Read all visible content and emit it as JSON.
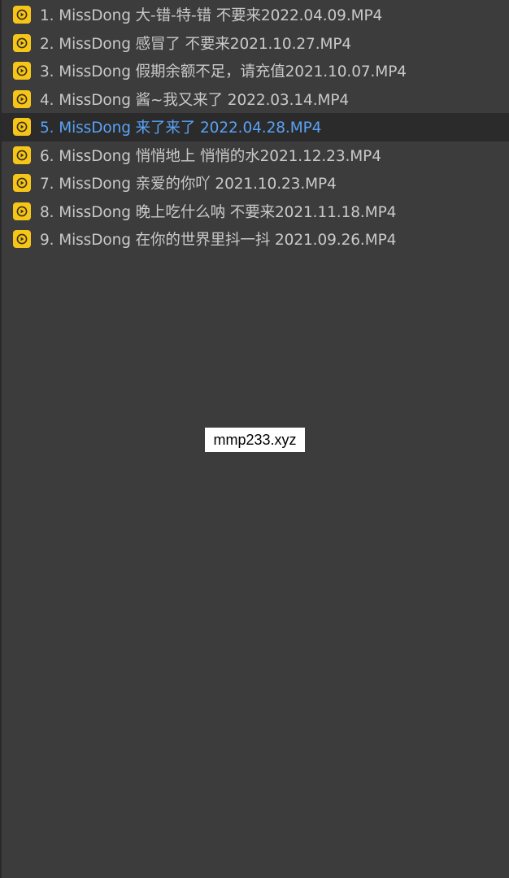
{
  "playlist": {
    "items": [
      {
        "label": "1. MissDong 大-错-特-错 不要来2022.04.09.MP4",
        "selected": false
      },
      {
        "label": "2. MissDong 感冒了 不要来2021.10.27.MP4",
        "selected": false
      },
      {
        "label": "3. MissDong 假期余额不足，请充值2021.10.07.MP4",
        "selected": false
      },
      {
        "label": "4. MissDong 酱~我又来了 2022.03.14.MP4",
        "selected": false
      },
      {
        "label": "5. MissDong 来了来了 2022.04.28.MP4",
        "selected": true
      },
      {
        "label": "6. MissDong 悄悄地上 悄悄的水2021.12.23.MP4",
        "selected": false
      },
      {
        "label": "7. MissDong 亲爱的你吖 2021.10.23.MP4",
        "selected": false
      },
      {
        "label": "8. MissDong 晚上吃什么呐 不要来2021.11.18.MP4",
        "selected": false
      },
      {
        "label": "9. MissDong 在你的世界里抖一抖 2021.09.26.MP4",
        "selected": false
      }
    ]
  },
  "watermark": {
    "text": "mmp233.xyz"
  },
  "colors": {
    "background": "#3c3c3c",
    "item_text": "#c9c9c9",
    "selected_text": "#5aa2f5",
    "selected_background": "#2b2b2b",
    "icon_accent": "#f5c51a"
  },
  "icons": {
    "item_icon": "play-icon"
  }
}
